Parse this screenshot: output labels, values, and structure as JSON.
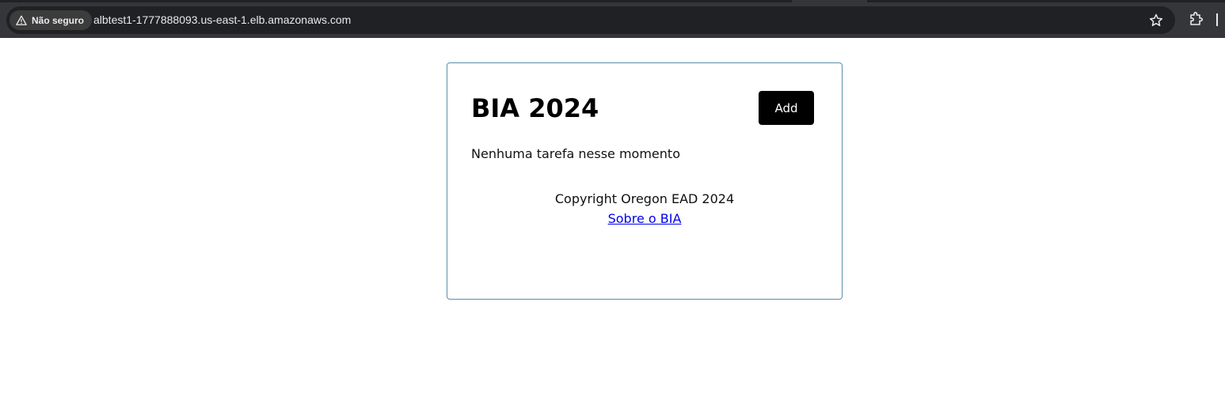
{
  "browser": {
    "security_label": "Não seguro",
    "url": "albtest1-1777888093.us-east-1.elb.amazonaws.com",
    "icons": {
      "security": "warning-triangle-icon",
      "bookmark": "star-icon",
      "extensions": "puzzle-piece-icon"
    },
    "colors": {
      "chrome_background": "#35363a",
      "omnibox_background": "#202124",
      "text": "#e8eaed"
    }
  },
  "page": {
    "title": "BIA 2024",
    "add_button_label": "Add",
    "empty_message": "Nenhuma tarefa nesse momento",
    "footer": {
      "copyright": "Copyright Oregon EAD 2024",
      "about_link": "Sobre o BIA"
    },
    "colors": {
      "card_border": "#5b8fa8",
      "button_background": "#000000",
      "button_text": "#ffffff",
      "link": "#0000ee"
    }
  }
}
